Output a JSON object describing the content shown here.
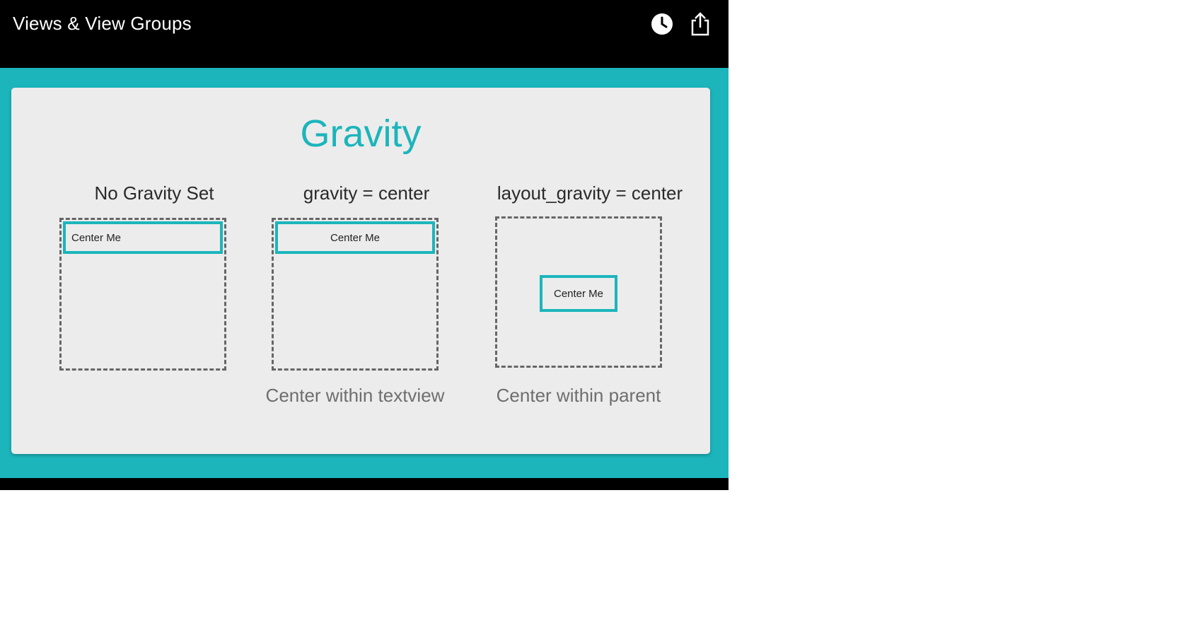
{
  "header": {
    "title": "Views & View Groups",
    "icons": [
      "clock-icon",
      "share-icon"
    ]
  },
  "slide": {
    "title": "Gravity",
    "accent_color": "#1bb5bb",
    "columns": [
      {
        "heading": "No Gravity Set",
        "child_text": "Center Me",
        "caption": ""
      },
      {
        "heading": "gravity  = center",
        "child_text": "Center Me",
        "caption": "Center within textview"
      },
      {
        "heading": "layout_gravity = center",
        "child_text": "Center Me",
        "caption": "Center within parent"
      }
    ]
  }
}
